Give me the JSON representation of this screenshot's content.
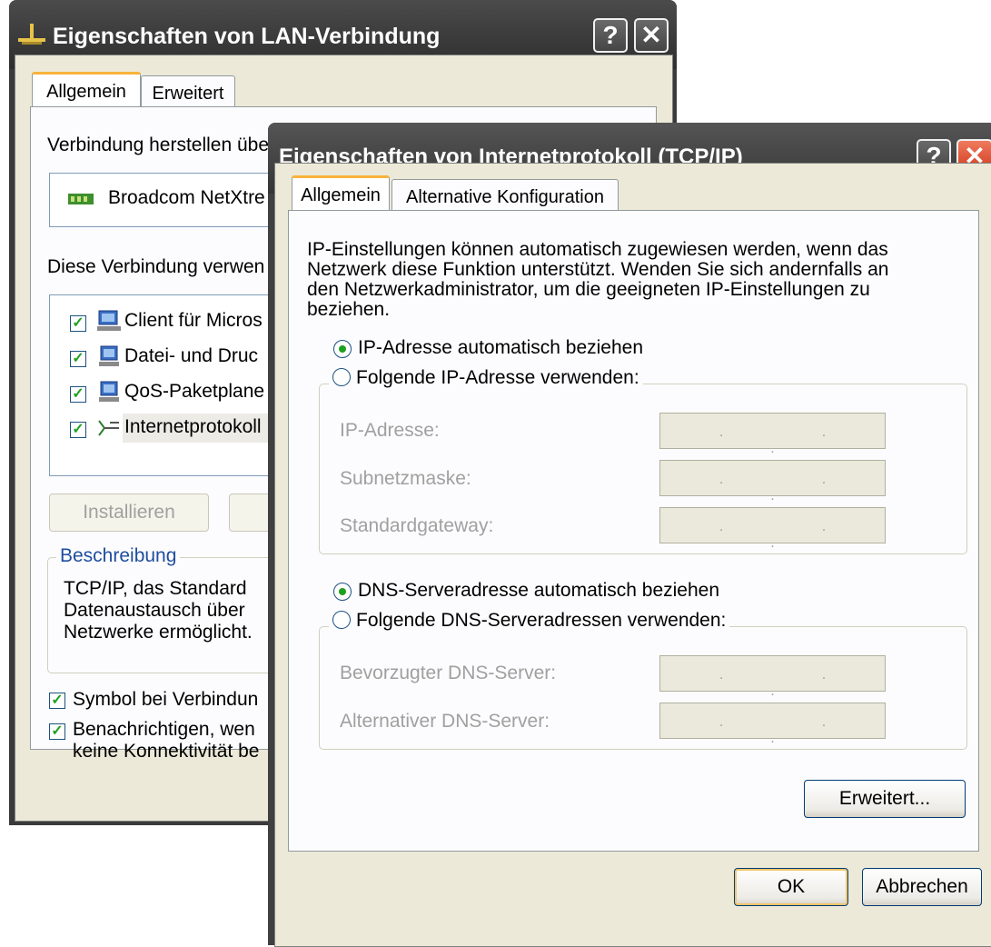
{
  "lan_window": {
    "title": "Eigenschaften von LAN-Verbindung",
    "tabs": [
      "Allgemein",
      "Erweitert"
    ],
    "connect_using_label": "Verbindung herstellen übe",
    "adapter_name": "Broadcom NetXtre",
    "uses_items_label": "Diese Verbindung verwen",
    "components": [
      {
        "label": "Client für Micros",
        "checked": true,
        "icon": "network-client-icon"
      },
      {
        "label": "Datei- und Druc",
        "checked": true,
        "icon": "network-service-icon"
      },
      {
        "label": "QoS-Paketplane",
        "checked": true,
        "icon": "network-service-icon"
      },
      {
        "label": "Internetprotokoll",
        "checked": true,
        "icon": "protocol-icon"
      }
    ],
    "install_button": "Installieren",
    "description_legend": "Beschreibung",
    "description_lines": [
      "TCP/IP, das Standard",
      "Datenaustausch über",
      "Netzwerke ermöglicht."
    ],
    "show_icon_label": "Symbol bei Verbindun",
    "notify_label_line1": "Benachrichtigen, wen",
    "notify_label_line2": "keine Konnektivität be"
  },
  "tcpip_window": {
    "title": "Eigenschaften von Internetprotokoll (TCP/IP)",
    "help_button": "?",
    "close_button": "✕",
    "tabs": [
      "Allgemein",
      "Alternative Konfiguration"
    ],
    "intro_lines": [
      "IP-Einstellungen können automatisch zugewiesen werden, wenn das",
      "Netzwerk diese Funktion unterstützt. Wenden Sie sich andernfalls an",
      "den Netzwerkadministrator, um die geeigneten IP-Einstellungen zu",
      "beziehen."
    ],
    "ip_auto_label": "IP-Adresse automatisch beziehen",
    "ip_manual_label": "Folgende IP-Adresse verwenden:",
    "ip_address_label": "IP-Adresse:",
    "subnet_label": "Subnetzmaske:",
    "gateway_label": "Standardgateway:",
    "dns_auto_label": "DNS-Serveradresse automatisch beziehen",
    "dns_manual_label": "Folgende DNS-Serveradressen verwenden:",
    "dns_preferred_label": "Bevorzugter DNS-Server:",
    "dns_alternate_label": "Alternativer DNS-Server:",
    "ip_placeholder": ". . .",
    "advanced_button": "Erweitert...",
    "ok_button": "OK",
    "cancel_button": "Abbrechen"
  },
  "lan_window_buttons": {
    "help": "?",
    "close": "✕"
  },
  "colors": {
    "close_button_red": "#e2462b",
    "tab_accent": "#f8b33a",
    "dialog_face": "#ece9d8"
  }
}
